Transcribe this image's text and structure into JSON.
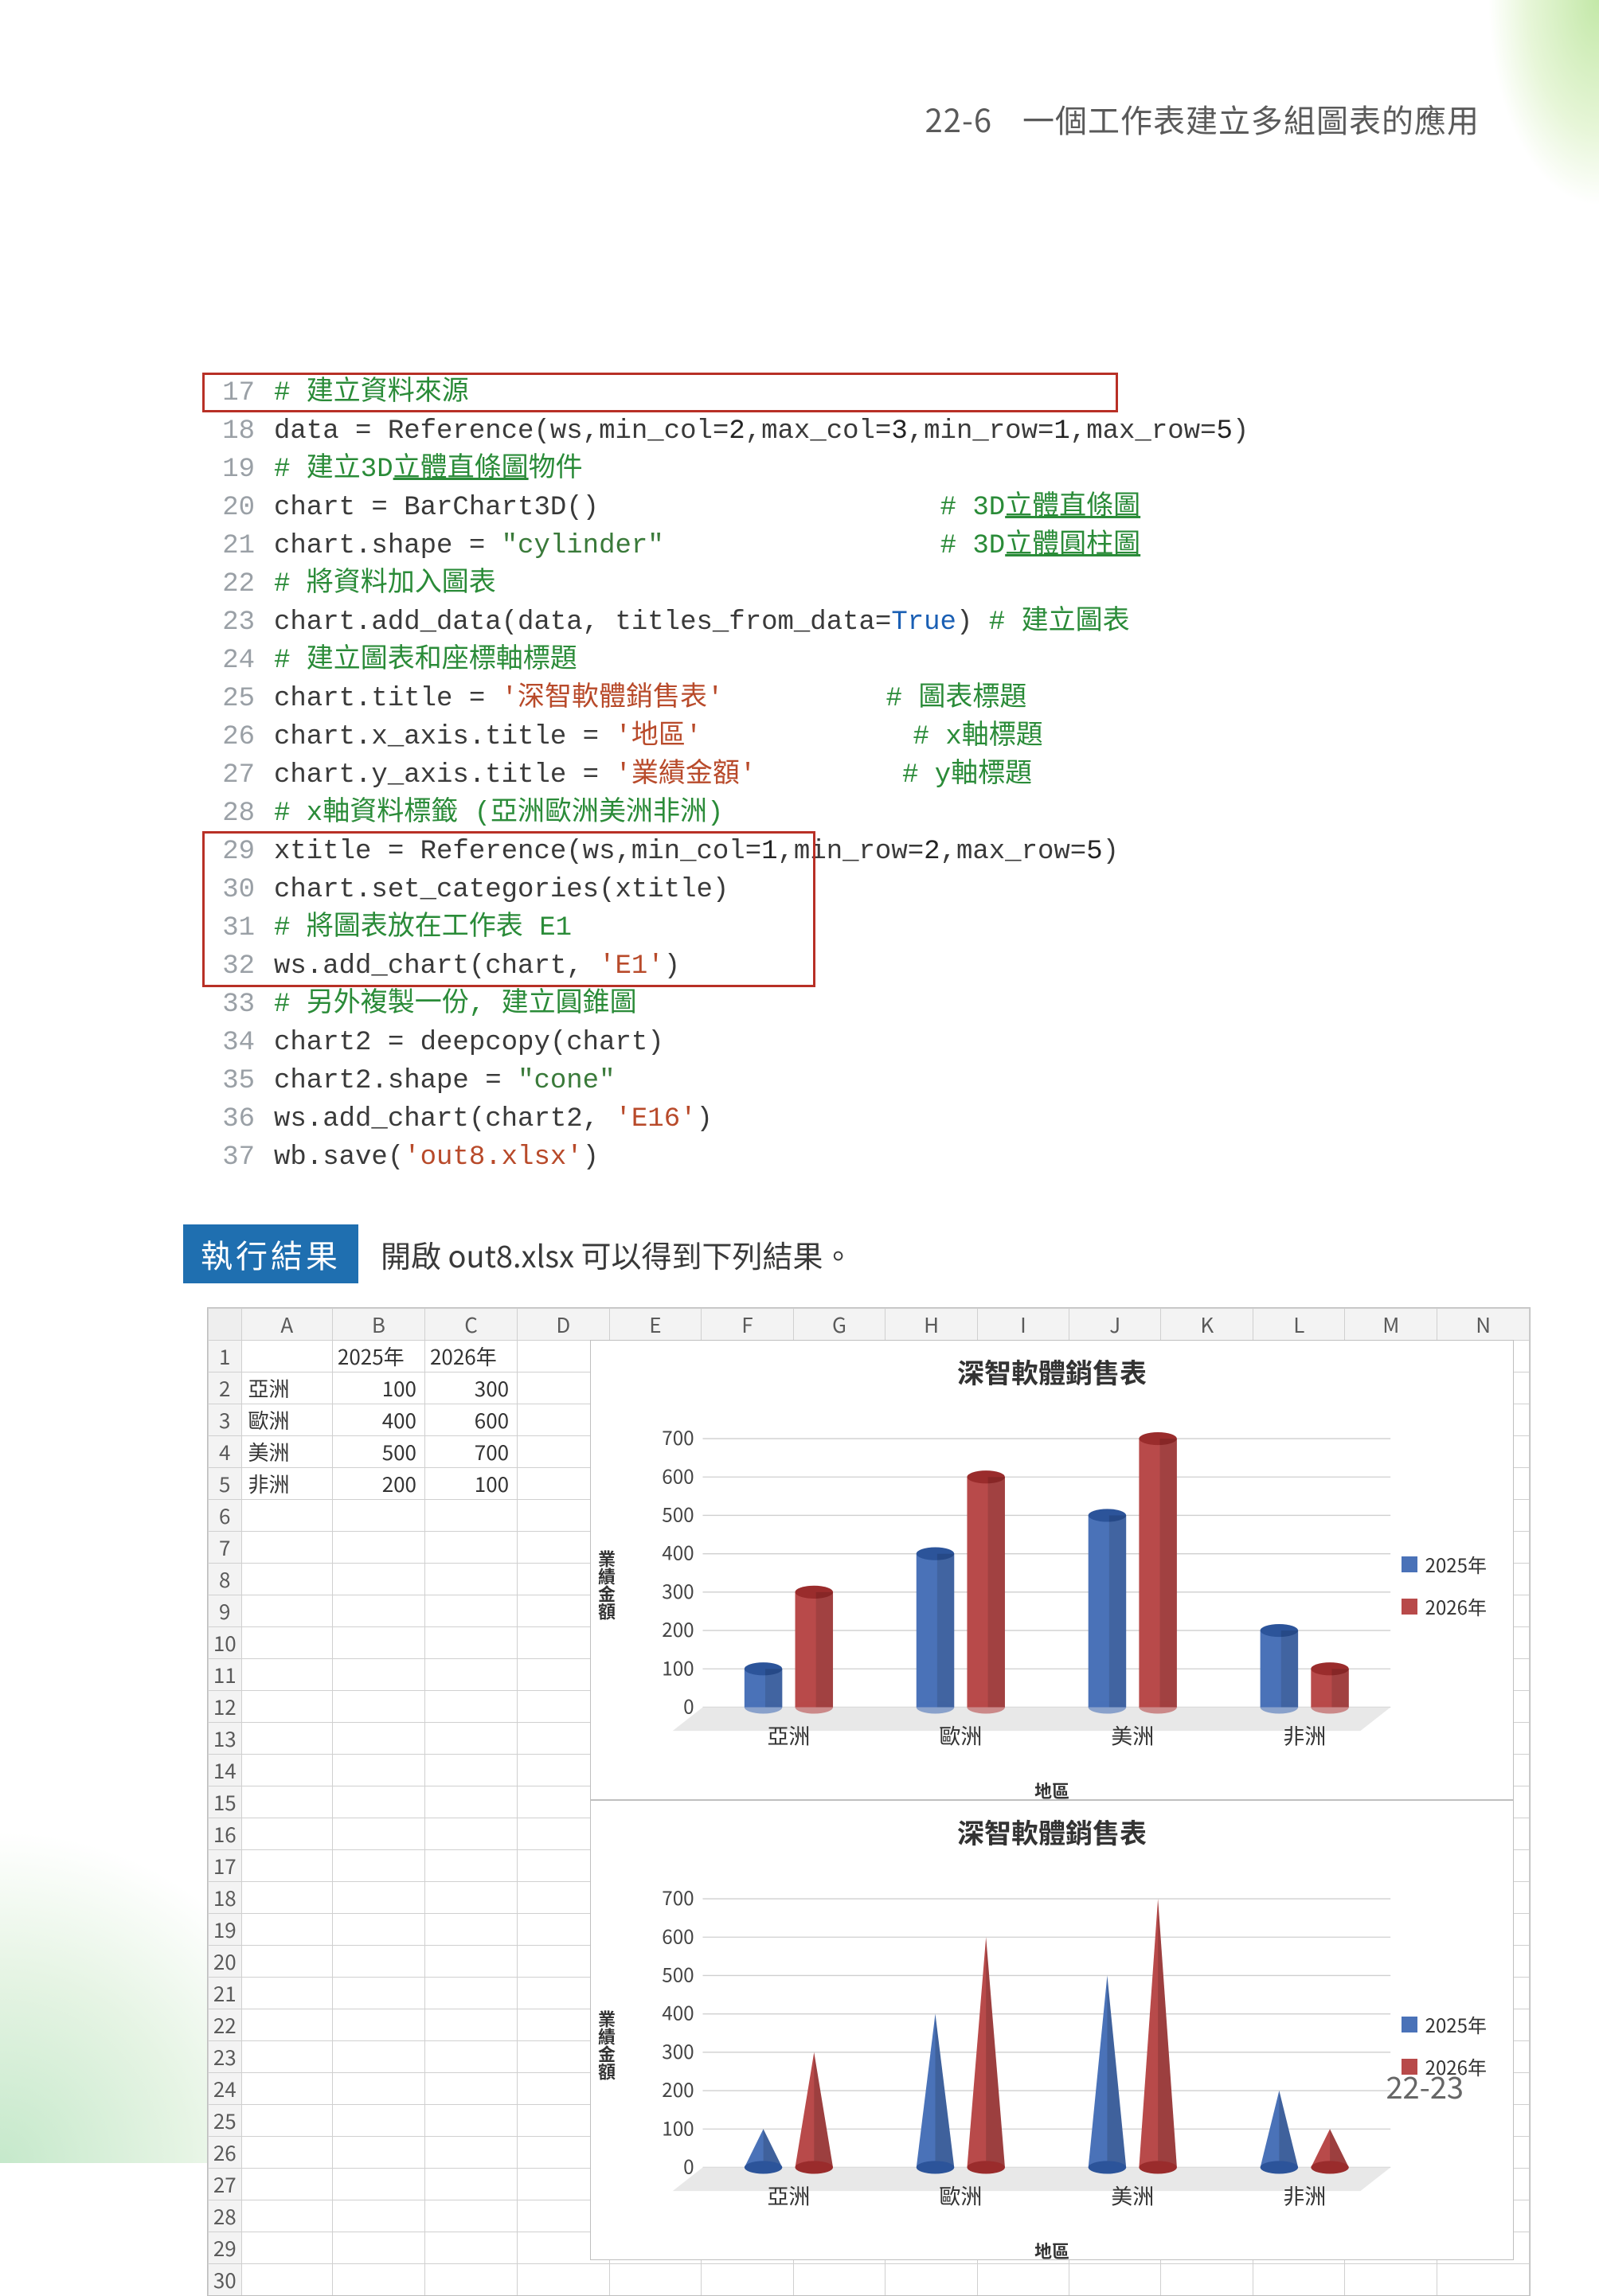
{
  "header": {
    "section": "22-6",
    "title": "一個工作表建立多組圖表的應用"
  },
  "code": [
    {
      "n": 17,
      "seg": [
        [
          "# 建立資料來源",
          "cmt"
        ]
      ]
    },
    {
      "n": 18,
      "seg": [
        [
          "data = Reference(ws,min_col=",
          ""
        ],
        [
          "2",
          "kw"
        ],
        [
          ",max_col=",
          ""
        ],
        [
          "3",
          "kw"
        ],
        [
          ",min_row=",
          ""
        ],
        [
          "1",
          "kw"
        ],
        [
          ",max_row=",
          ""
        ],
        [
          "5",
          "kw"
        ],
        [
          ")",
          ""
        ]
      ]
    },
    {
      "n": 19,
      "seg": [
        [
          "# 建立3D",
          "cmt"
        ],
        [
          "立體直條圖",
          "cmt u"
        ],
        [
          "物件",
          "cmt"
        ]
      ]
    },
    {
      "n": 20,
      "seg": [
        [
          "chart = BarChart3D()                     ",
          ""
        ],
        [
          "# 3D",
          "cmt"
        ],
        [
          "立體直條圖",
          "cmt u"
        ]
      ]
    },
    {
      "n": 21,
      "seg": [
        [
          "chart.shape = ",
          ""
        ],
        [
          "\"cylinder\"",
          "str2"
        ],
        [
          "                 ",
          ""
        ],
        [
          "# 3D",
          "cmt"
        ],
        [
          "立體圓柱圖",
          "cmt u"
        ]
      ]
    },
    {
      "n": 22,
      "seg": [
        [
          "# 將資料加入圖表",
          "cmt"
        ]
      ]
    },
    {
      "n": 23,
      "seg": [
        [
          "chart.add_data(data, titles_from_data=",
          ""
        ],
        [
          "True",
          "bool"
        ],
        [
          ") ",
          ""
        ],
        [
          "# 建立圖表",
          "cmt"
        ]
      ]
    },
    {
      "n": 24,
      "seg": [
        [
          "# 建立圖表和座標軸標題",
          "cmt"
        ]
      ]
    },
    {
      "n": 25,
      "seg": [
        [
          "chart.title = ",
          ""
        ],
        [
          "'深智軟體銷售表'",
          "str"
        ],
        [
          "          ",
          ""
        ],
        [
          "# 圖表標題",
          "cmt"
        ]
      ]
    },
    {
      "n": 26,
      "seg": [
        [
          "chart.x_axis.title = ",
          ""
        ],
        [
          "'地區'",
          "str"
        ],
        [
          "             ",
          ""
        ],
        [
          "# x軸標題",
          "cmt"
        ]
      ]
    },
    {
      "n": 27,
      "seg": [
        [
          "chart.y_axis.title = ",
          ""
        ],
        [
          "'業績金額'",
          "str"
        ],
        [
          "         ",
          ""
        ],
        [
          "# y軸標題",
          "cmt"
        ]
      ]
    },
    {
      "n": 28,
      "seg": [
        [
          "# x軸資料標籤 (亞洲歐洲美洲非洲)",
          "cmt"
        ]
      ]
    },
    {
      "n": 29,
      "seg": [
        [
          "xtitle = Reference(ws,min_col=",
          ""
        ],
        [
          "1",
          "kw"
        ],
        [
          ",min_row=",
          ""
        ],
        [
          "2",
          "kw"
        ],
        [
          ",max_row=",
          ""
        ],
        [
          "5",
          "kw"
        ],
        [
          ")",
          ""
        ]
      ]
    },
    {
      "n": 30,
      "seg": [
        [
          "chart.set_categories(xtitle)",
          ""
        ]
      ]
    },
    {
      "n": 31,
      "seg": [
        [
          "# 將圖表放在工作表 E1",
          "cmt"
        ]
      ]
    },
    {
      "n": 32,
      "seg": [
        [
          "ws.add_chart(chart, ",
          ""
        ],
        [
          "'E1'",
          "str"
        ],
        [
          ")",
          ""
        ]
      ]
    },
    {
      "n": 33,
      "seg": [
        [
          "# 另外複製一份, 建立圓錐圖",
          "cmt"
        ]
      ]
    },
    {
      "n": 34,
      "seg": [
        [
          "chart2 = deepcopy(chart)",
          ""
        ]
      ]
    },
    {
      "n": 35,
      "seg": [
        [
          "chart2.shape = ",
          ""
        ],
        [
          "\"cone\"",
          "str2"
        ]
      ]
    },
    {
      "n": 36,
      "seg": [
        [
          "ws.add_chart(chart2, ",
          ""
        ],
        [
          "'E16'",
          "str"
        ],
        [
          ")",
          ""
        ]
      ]
    },
    {
      "n": 37,
      "seg": [
        [
          "wb.save(",
          ""
        ],
        [
          "'out8.xlsx'",
          "str"
        ],
        [
          ")",
          ""
        ]
      ]
    }
  ],
  "result_badge": "執行結果",
  "result_text": "開啟 out8.xlsx 可以得到下列結果。",
  "spreadsheet": {
    "columns": [
      "A",
      "B",
      "C",
      "D",
      "E",
      "F",
      "G",
      "H",
      "I",
      "J",
      "K",
      "L",
      "M",
      "N"
    ],
    "header_row": [
      "",
      "2025年",
      "2026年"
    ],
    "rows": [
      [
        "亞洲",
        "100",
        "300"
      ],
      [
        "歐洲",
        "400",
        "600"
      ],
      [
        "美洲",
        "500",
        "700"
      ],
      [
        "非洲",
        "200",
        "100"
      ]
    ],
    "total_rows": 30
  },
  "chart_data": [
    {
      "type": "bar",
      "shape": "cylinder",
      "title": "深智軟體銷售表",
      "xlabel": "地區",
      "ylabel": "業績金額",
      "categories": [
        "亞洲",
        "歐洲",
        "美洲",
        "非洲"
      ],
      "series": [
        {
          "name": "2025年",
          "values": [
            100,
            400,
            500,
            200
          ],
          "color": "#4a72b8"
        },
        {
          "name": "2026年",
          "values": [
            300,
            600,
            700,
            100
          ],
          "color": "#b84a4a"
        }
      ],
      "ylim": [
        0,
        700
      ],
      "yticks": [
        0,
        100,
        200,
        300,
        400,
        500,
        600,
        700
      ]
    },
    {
      "type": "bar",
      "shape": "cone",
      "title": "深智軟體銷售表",
      "xlabel": "地區",
      "ylabel": "業績金額",
      "categories": [
        "亞洲",
        "歐洲",
        "美洲",
        "非洲"
      ],
      "series": [
        {
          "name": "2025年",
          "values": [
            100,
            400,
            500,
            200
          ],
          "color": "#4a72b8"
        },
        {
          "name": "2026年",
          "values": [
            300,
            600,
            700,
            100
          ],
          "color": "#b84a4a"
        }
      ],
      "ylim": [
        0,
        700
      ],
      "yticks": [
        0,
        100,
        200,
        300,
        400,
        500,
        600,
        700
      ]
    }
  ],
  "footer": "22-23"
}
